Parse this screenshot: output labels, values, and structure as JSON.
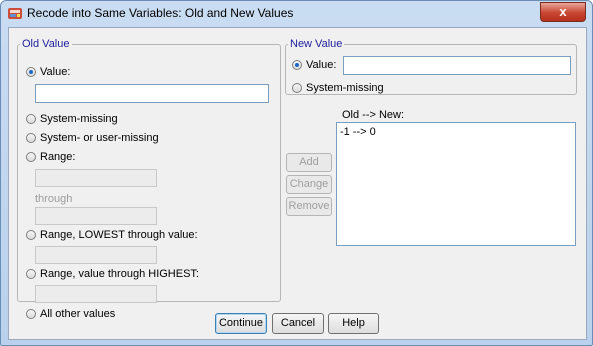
{
  "window": {
    "title": "Recode into Same Variables: Old and New Values",
    "close_label": "x"
  },
  "old_value": {
    "legend": "Old Value",
    "value_label": "Value:",
    "value_text": "",
    "system_missing_label": "System-missing",
    "system_user_missing_label": "System- or user-missing",
    "range_label": "Range:",
    "through_label": "through",
    "range_lowest_label": "Range, LOWEST through value:",
    "range_highest_label": "Range, value through HIGHEST:",
    "all_other_label": "All other values"
  },
  "new_value": {
    "legend": "New Value",
    "value_label": "Value:",
    "value_text": "",
    "system_missing_label": "System-missing"
  },
  "mapping": {
    "label": "Old --> New:",
    "items": [
      "-1 --> 0"
    ]
  },
  "buttons": {
    "add": "Add",
    "change": "Change",
    "remove": "Remove",
    "continue": "Continue",
    "cancel": "Cancel",
    "help": "Help"
  },
  "colors": {
    "accent": "#1e1e9e",
    "close": "#c74632",
    "radio_selected": "#1b66c4"
  },
  "icons": {
    "title": "spss-recode-icon",
    "close": "close-icon"
  }
}
